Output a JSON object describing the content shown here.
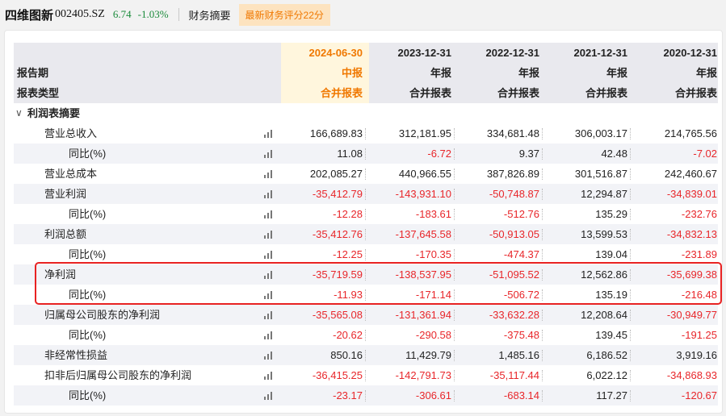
{
  "header": {
    "stock_name": "四维图新",
    "stock_code": "002405.SZ",
    "price": "6.74",
    "change": "-1.03%",
    "tab_summary": "财务摘要",
    "tab_score": "最新财务评分22分"
  },
  "table": {
    "columns": [
      "2024-06-30",
      "2023-12-31",
      "2022-12-31",
      "2021-12-31",
      "2020-12-31"
    ],
    "report_period_label": "报告期",
    "report_periods": [
      "中报",
      "年报",
      "年报",
      "年报",
      "年报"
    ],
    "report_type_label": "报表类型",
    "report_types": [
      "合并报表",
      "合并报表",
      "合并报表",
      "合并报表",
      "合并报表"
    ],
    "section_title": "利润表摘要",
    "rows": [
      {
        "label": "营业总收入",
        "indent": 1,
        "values": [
          "166,689.83",
          "312,181.95",
          "334,681.48",
          "306,003.17",
          "214,765.56"
        ]
      },
      {
        "label": "同比(%)",
        "indent": 2,
        "values": [
          "11.08",
          "-6.72",
          "9.37",
          "42.48",
          "-7.02"
        ]
      },
      {
        "label": "营业总成本",
        "indent": 1,
        "values": [
          "202,085.27",
          "440,966.55",
          "387,826.89",
          "301,516.87",
          "242,460.67"
        ]
      },
      {
        "label": "营业利润",
        "indent": 1,
        "values": [
          "-35,412.79",
          "-143,931.10",
          "-50,748.87",
          "12,294.87",
          "-34,839.01"
        ]
      },
      {
        "label": "同比(%)",
        "indent": 2,
        "values": [
          "-12.28",
          "-183.61",
          "-512.76",
          "135.29",
          "-232.76"
        ]
      },
      {
        "label": "利润总额",
        "indent": 1,
        "values": [
          "-35,412.76",
          "-137,645.58",
          "-50,913.05",
          "13,599.53",
          "-34,832.13"
        ]
      },
      {
        "label": "同比(%)",
        "indent": 2,
        "values": [
          "-12.25",
          "-170.35",
          "-474.37",
          "139.04",
          "-231.89"
        ]
      },
      {
        "label": "净利润",
        "indent": 1,
        "values": [
          "-35,719.59",
          "-138,537.95",
          "-51,095.52",
          "12,562.86",
          "-35,699.38"
        ]
      },
      {
        "label": "同比(%)",
        "indent": 2,
        "values": [
          "-11.93",
          "-171.14",
          "-506.72",
          "135.19",
          "-216.48"
        ]
      },
      {
        "label": "归属母公司股东的净利润",
        "indent": 1,
        "values": [
          "-35,565.08",
          "-131,361.94",
          "-33,632.28",
          "12,208.64",
          "-30,949.77"
        ]
      },
      {
        "label": "同比(%)",
        "indent": 2,
        "values": [
          "-20.62",
          "-290.58",
          "-375.48",
          "139.45",
          "-191.25"
        ]
      },
      {
        "label": "非经常性损益",
        "indent": 1,
        "values": [
          "850.16",
          "11,429.79",
          "1,485.16",
          "6,186.52",
          "3,919.16"
        ]
      },
      {
        "label": "扣非后归属母公司股东的净利润",
        "indent": 1,
        "values": [
          "-36,415.25",
          "-142,791.73",
          "-35,117.44",
          "6,022.12",
          "-34,868.93"
        ]
      },
      {
        "label": "同比(%)",
        "indent": 2,
        "values": [
          "-23.17",
          "-306.61",
          "-683.14",
          "117.27",
          "-120.67"
        ]
      }
    ]
  },
  "colors": {
    "accent": "#f07800",
    "negative": "#e8262a",
    "positive_quote": "#1a8a3a",
    "highlight_box": "#e82222"
  }
}
